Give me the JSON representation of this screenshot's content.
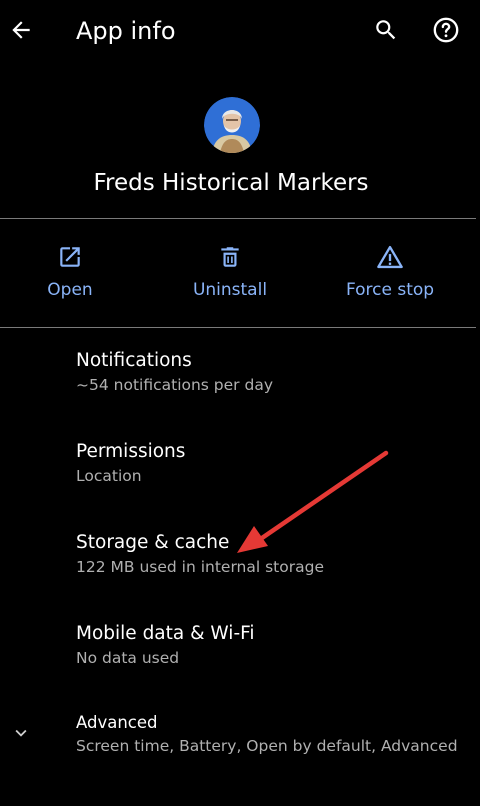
{
  "appbar": {
    "title": "App info",
    "back_icon": "arrow-back-icon",
    "search_icon": "search-icon",
    "help_icon": "help-icon"
  },
  "app": {
    "name": "Freds Historical Markers",
    "icon": "app-avatar-icon"
  },
  "actions": [
    {
      "label": "Open",
      "icon": "open-in-new-icon"
    },
    {
      "label": "Uninstall",
      "icon": "trash-icon"
    },
    {
      "label": "Force stop",
      "icon": "warning-icon"
    }
  ],
  "settings": {
    "notifications": {
      "title": "Notifications",
      "summary": "~54 notifications per day"
    },
    "permissions": {
      "title": "Permissions",
      "summary": "Location"
    },
    "storage": {
      "title": "Storage & cache",
      "summary": "122 MB used in internal storage"
    },
    "mobile_data": {
      "title": "Mobile data & Wi-Fi",
      "summary": "No data used"
    },
    "advanced": {
      "title": "Advanced",
      "summary": "Screen time, Battery, Open by default, Advanced",
      "icon": "chevron-down-icon"
    }
  },
  "colors": {
    "background": "#000000",
    "accent": "#8ab4f8",
    "text_primary": "#ffffff",
    "text_secondary": "#b0b0b0",
    "annotation_arrow": "#e53935"
  }
}
